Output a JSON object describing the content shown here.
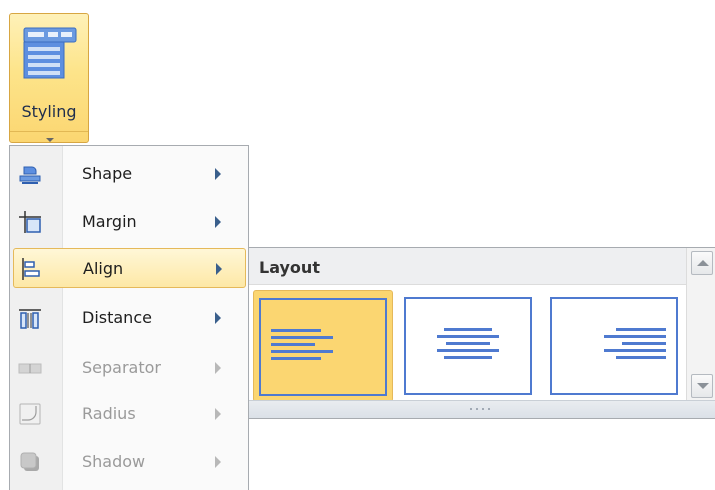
{
  "ribbon": {
    "styling_label": "Styling",
    "styling_icon": "styling-table-icon"
  },
  "menu": {
    "items": [
      {
        "label": "Shape",
        "icon": "shape-icon",
        "enabled": true,
        "has_submenu": true
      },
      {
        "label": "Margin",
        "icon": "margin-icon",
        "enabled": true,
        "has_submenu": true
      },
      {
        "label": "Align",
        "icon": "align-icon",
        "enabled": true,
        "has_submenu": true,
        "active": true
      },
      {
        "label": "Distance",
        "icon": "distance-icon",
        "enabled": true,
        "has_submenu": true
      },
      {
        "label": "Separator",
        "icon": "separator-icon",
        "enabled": false,
        "has_submenu": true
      },
      {
        "label": "Radius",
        "icon": "radius-icon",
        "enabled": false,
        "has_submenu": true
      },
      {
        "label": "Shadow",
        "icon": "shadow-icon",
        "enabled": false,
        "has_submenu": true
      }
    ]
  },
  "gallery": {
    "header": "Layout",
    "options": [
      {
        "name": "align-left",
        "selected": true
      },
      {
        "name": "align-center",
        "selected": false
      },
      {
        "name": "align-right",
        "selected": false
      }
    ]
  },
  "colors": {
    "highlight": "#fbd671",
    "highlight_border": "#e5b95a",
    "accent_blue": "#4f7ad0",
    "submenu_arrow": "#3a5f8c",
    "disabled_text": "#9a9a9a"
  }
}
